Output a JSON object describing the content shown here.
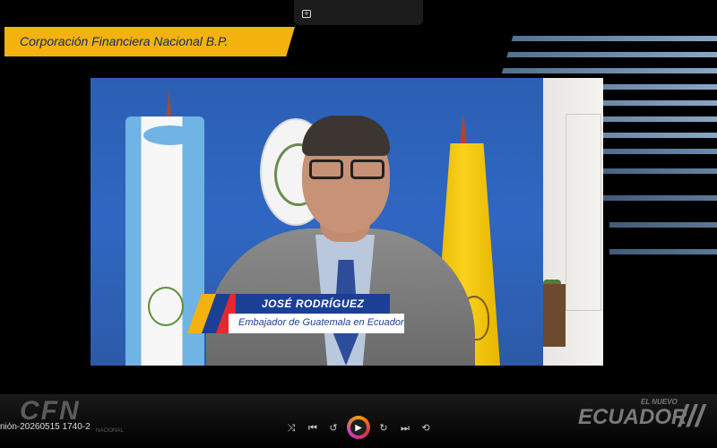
{
  "header": {
    "banner_text": "Corporación Financiera Nacional B.P.",
    "top_control_icon": "picture-in-picture-icon"
  },
  "lower_third": {
    "name": "JOSÉ RODRÍGUEZ",
    "title": "Embajador de Guatemala en Ecuador",
    "accent_colors": [
      "#f4b20f",
      "#1c3f96",
      "#e4282e"
    ]
  },
  "footer": {
    "logo_text": "CFN",
    "logo_subtext": "NACIONAL",
    "campaign_small": "EL NUEVO",
    "campaign_big": "ECUADOR",
    "file_name": "nión-20260515 1740-2"
  },
  "player": {
    "icons": [
      "shuffle-icon",
      "previous-icon",
      "rewind-10-icon",
      "play-icon",
      "forward-30-icon",
      "next-icon",
      "repeat-icon"
    ]
  },
  "colors": {
    "banner_bg": "#f4b20f",
    "banner_text": "#102b6a",
    "name_bar": "#1c3f96"
  }
}
